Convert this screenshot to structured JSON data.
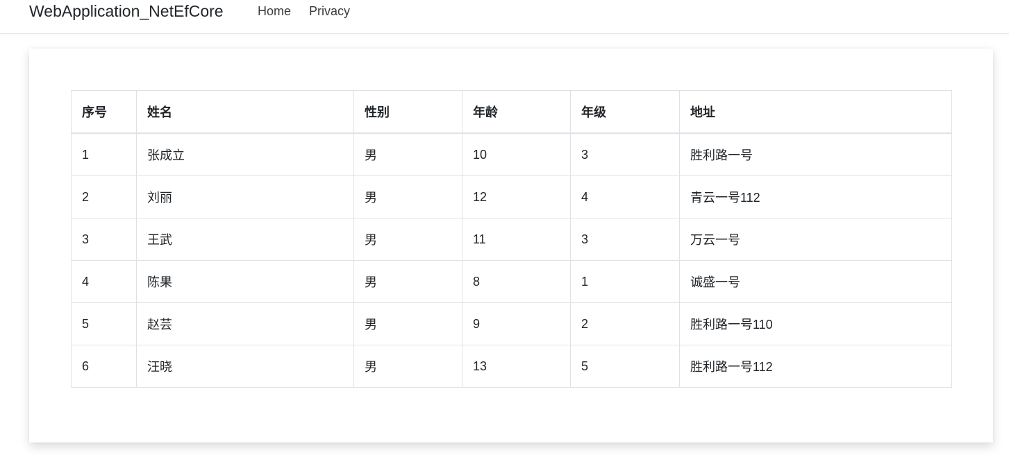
{
  "navbar": {
    "brand": "WebApplication_NetEfCore",
    "links": [
      {
        "label": "Home"
      },
      {
        "label": "Privacy"
      }
    ]
  },
  "table": {
    "headers": [
      "序号",
      "姓名",
      "性别",
      "年龄",
      "年级",
      "地址"
    ],
    "rows": [
      [
        "1",
        "张成立",
        "男",
        "10",
        "3",
        "胜利路一号"
      ],
      [
        "2",
        "刘丽",
        "男",
        "12",
        "4",
        "青云一号112"
      ],
      [
        "3",
        "王武",
        "男",
        "11",
        "3",
        "万云一号"
      ],
      [
        "4",
        "陈果",
        "男",
        "8",
        "1",
        "诚盛一号"
      ],
      [
        "5",
        "赵芸",
        "男",
        "9",
        "2",
        "胜利路一号110"
      ],
      [
        "6",
        "汪晓",
        "男",
        "13",
        "5",
        "胜利路一号112"
      ]
    ]
  }
}
